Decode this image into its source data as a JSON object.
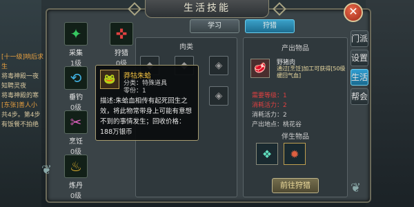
{
  "window": {
    "title": "生活技能",
    "close_label": "✕"
  },
  "tabs": [
    {
      "label": "学习",
      "active": false
    },
    {
      "label": "狩猎",
      "active": true
    }
  ],
  "skills": [
    {
      "name": "采集",
      "level": "1级",
      "icon": "gather-icon",
      "glyph": "✦",
      "color": "#36c860"
    },
    {
      "name": "狩猎",
      "level": "0级",
      "icon": "hunt-icon",
      "glyph": "✜",
      "color": "#e04040"
    },
    {
      "name": "垂钓",
      "level": "0级",
      "icon": "fishing-icon",
      "glyph": "⟲",
      "color": "#40b0e0"
    },
    {
      "name": "烹饪",
      "level": "0级",
      "icon": "cooking-icon",
      "glyph": "✂",
      "color": "#e060c0"
    },
    {
      "name": "炼丹",
      "level": "0级",
      "icon": "alchemy-icon",
      "glyph": "♨",
      "color": "#e0b030"
    }
  ],
  "meat_section": {
    "title": "肉类"
  },
  "produce_section": {
    "title": "产出物品",
    "item_name": "野猪肉",
    "item_desc": "通过[烹饪]加工可获得[50级缓回气血]",
    "red_line1": "需要等级：1",
    "red_line2": "消耗活力：2",
    "consume": "消耗活力：2",
    "location": "产出地点：桃花谷"
  },
  "partner_section": {
    "title": "伴生物品"
  },
  "hunt_button": "前往狩猎",
  "side_tabs": [
    {
      "label": "门派",
      "active": false
    },
    {
      "label": "设置",
      "active": false
    },
    {
      "label": "生活",
      "active": true
    },
    {
      "label": "帮会",
      "active": false
    }
  ],
  "tooltip": {
    "name": "莽牯朱蛤",
    "category": "分类：特殊道具",
    "quantity": "零份：1",
    "description": "描述:朱蛤血相传有起死回生之效，将此物常带身上可能有意想不到的事情发生；回收价格：188万银币"
  },
  "chat": [
    "[十一级]响后求生",
    "将毒神殿一夜",
    "知聘灵夜",
    "将毒神殿的寒",
    "[东张]善人小",
    "共4步。第4步",
    "有饭餐不拍绝"
  ]
}
